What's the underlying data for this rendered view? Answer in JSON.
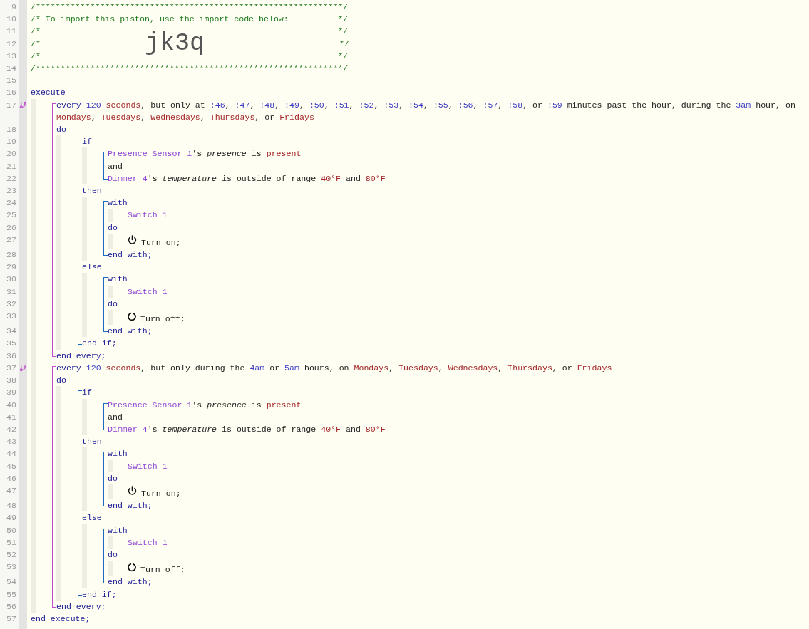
{
  "code": [
    {
      "kind": "line",
      "num": "9",
      "tokens": [
        {
          "text": "/**************************************************************/",
          "kind": "cmt"
        }
      ]
    },
    {
      "kind": "line",
      "num": "10",
      "tokens": [
        {
          "text": "/* To import this piston, use the import code below:          */",
          "kind": "cmt"
        }
      ]
    },
    {
      "kind": "line",
      "num": "11",
      "tokens": [
        {
          "text": "/*                                                            */",
          "kind": "cmt"
        }
      ]
    },
    {
      "kind": "import",
      "num": "12",
      "head": "/*",
      "import_code": "jk3q",
      "tail": "*/"
    },
    {
      "kind": "line",
      "num": "13",
      "tokens": [
        {
          "text": "/*                                                            */",
          "kind": "cmt"
        }
      ]
    },
    {
      "kind": "line",
      "num": "14",
      "tokens": [
        {
          "text": "/**************************************************************/",
          "kind": "cmt"
        }
      ]
    },
    {
      "kind": "line",
      "num": "15"
    },
    {
      "kind": "line",
      "num": "16",
      "tokens": [
        {
          "text": "execute",
          "kind": "kw"
        }
      ],
      "children": [
        {
          "kind": "every",
          "items": [
            {
              "kind": "trigger",
              "num": "17",
              "tokens": [
                {
                  "text": "every",
                  "kind": "kw"
                },
                {
                  "text": " 120",
                  "kind": "num"
                },
                {
                  "text": " seconds",
                  "kind": "val"
                },
                {
                  "text": ", but only at ",
                  "kind": "txt"
                },
                {
                  "text": ":46",
                  "kind": "num"
                },
                {
                  "text": ", ",
                  "kind": "txt"
                },
                {
                  "text": ":47",
                  "kind": "num"
                },
                {
                  "text": ", ",
                  "kind": "txt"
                },
                {
                  "text": ":48",
                  "kind": "num"
                },
                {
                  "text": ", ",
                  "kind": "txt"
                },
                {
                  "text": ":49",
                  "kind": "num"
                },
                {
                  "text": ", ",
                  "kind": "txt"
                },
                {
                  "text": ":50",
                  "kind": "num"
                },
                {
                  "text": ", ",
                  "kind": "txt"
                },
                {
                  "text": ":51",
                  "kind": "num"
                },
                {
                  "text": ", ",
                  "kind": "txt"
                },
                {
                  "text": ":52",
                  "kind": "num"
                },
                {
                  "text": ", ",
                  "kind": "txt"
                },
                {
                  "text": ":53",
                  "kind": "num"
                },
                {
                  "text": ", ",
                  "kind": "txt"
                },
                {
                  "text": ":54",
                  "kind": "num"
                },
                {
                  "text": ", ",
                  "kind": "txt"
                },
                {
                  "text": ":55",
                  "kind": "num"
                },
                {
                  "text": ", ",
                  "kind": "txt"
                },
                {
                  "text": ":56",
                  "kind": "num"
                },
                {
                  "text": ", ",
                  "kind": "txt"
                },
                {
                  "text": ":57",
                  "kind": "num"
                },
                {
                  "text": ", ",
                  "kind": "txt"
                },
                {
                  "text": ":58",
                  "kind": "num"
                },
                {
                  "text": ", or ",
                  "kind": "txt"
                },
                {
                  "text": ":59",
                  "kind": "num"
                },
                {
                  "text": " minutes past the hour, during the ",
                  "kind": "txt"
                },
                {
                  "text": "3am",
                  "kind": "num"
                },
                {
                  "text": " hour, on ",
                  "kind": "txt"
                },
                {
                  "text": "Mondays",
                  "kind": "val"
                },
                {
                  "text": ", ",
                  "kind": "txt"
                },
                {
                  "text": "Tuesdays",
                  "kind": "val"
                },
                {
                  "text": ", ",
                  "kind": "txt"
                },
                {
                  "text": "Wednesdays",
                  "kind": "val"
                },
                {
                  "text": ", ",
                  "kind": "txt"
                },
                {
                  "text": "Thursdays",
                  "kind": "val"
                },
                {
                  "text": ", or ",
                  "kind": "txt"
                },
                {
                  "text": "Fridays",
                  "kind": "val"
                }
              ]
            },
            {
              "kind": "line",
              "num": "18",
              "tokens": [
                {
                  "text": "do",
                  "kind": "kw"
                }
              ],
              "children": [
                {
                  "kind": "block",
                  "items": [
                    {
                      "kind": "line",
                      "num": "19",
                      "tokens": [
                        {
                          "text": "if",
                          "kind": "kw"
                        }
                      ],
                      "children": [
                        {
                          "kind": "block",
                          "items": [
                            {
                              "kind": "line",
                              "num": "20",
                              "tokens": [
                                {
                                  "text": "Presence Sensor 1",
                                  "kind": "dev"
                                },
                                {
                                  "text": "'s ",
                                  "kind": "txt"
                                },
                                {
                                  "text": "presence",
                                  "kind": "attr"
                                },
                                {
                                  "text": " is ",
                                  "kind": "txt"
                                },
                                {
                                  "text": "present",
                                  "kind": "val"
                                }
                              ]
                            },
                            {
                              "kind": "line",
                              "num": "21",
                              "tokens": [
                                {
                                  "text": "and",
                                  "kind": "txt"
                                }
                              ]
                            },
                            {
                              "kind": "line",
                              "num": "22",
                              "tokens": [
                                {
                                  "text": "Dimmer 4",
                                  "kind": "dev"
                                },
                                {
                                  "text": "'s ",
                                  "kind": "txt"
                                },
                                {
                                  "text": "temperature",
                                  "kind": "attr"
                                },
                                {
                                  "text": " is outside of range ",
                                  "kind": "txt"
                                },
                                {
                                  "text": "40°F",
                                  "kind": "val"
                                },
                                {
                                  "text": " and ",
                                  "kind": "txt"
                                },
                                {
                                  "text": "80°F",
                                  "kind": "val"
                                }
                              ]
                            }
                          ]
                        }
                      ]
                    },
                    {
                      "kind": "line",
                      "num": "23",
                      "tokens": [
                        {
                          "text": "then",
                          "kind": "kw"
                        }
                      ],
                      "children": [
                        {
                          "kind": "block",
                          "items": [
                            {
                              "kind": "line",
                              "num": "24",
                              "tokens": [
                                {
                                  "text": "with",
                                  "kind": "kw"
                                }
                              ],
                              "children": [
                                {
                                  "kind": "line",
                                  "num": "25",
                                  "tokens": [
                                    {
                                      "text": "Switch 1",
                                      "kind": "dev"
                                    }
                                  ]
                                }
                              ]
                            },
                            {
                              "kind": "line",
                              "num": "26",
                              "tokens": [
                                {
                                  "text": "do",
                                  "kind": "kw"
                                }
                              ],
                              "children": [
                                {
                                  "kind": "poweron",
                                  "num": "27",
                                  "tokens": [
                                    {
                                      "text": "Turn on;",
                                      "kind": "txt"
                                    }
                                  ]
                                }
                              ]
                            },
                            {
                              "kind": "line",
                              "num": "28",
                              "tokens": [
                                {
                                  "text": "end with;",
                                  "kind": "kw"
                                }
                              ]
                            }
                          ]
                        }
                      ]
                    },
                    {
                      "kind": "line",
                      "num": "29",
                      "tokens": [
                        {
                          "text": "else",
                          "kind": "kw"
                        }
                      ],
                      "children": [
                        {
                          "kind": "block",
                          "items": [
                            {
                              "kind": "line",
                              "num": "30",
                              "tokens": [
                                {
                                  "text": "with",
                                  "kind": "kw"
                                }
                              ],
                              "children": [
                                {
                                  "kind": "line",
                                  "num": "31",
                                  "tokens": [
                                    {
                                      "text": "Switch 1",
                                      "kind": "dev"
                                    }
                                  ]
                                }
                              ]
                            },
                            {
                              "kind": "line",
                              "num": "32",
                              "tokens": [
                                {
                                  "text": "do",
                                  "kind": "kw"
                                }
                              ],
                              "children": [
                                {
                                  "kind": "poweroff",
                                  "num": "33",
                                  "tokens": [
                                    {
                                      "text": "Turn off;",
                                      "kind": "txt"
                                    }
                                  ]
                                }
                              ]
                            },
                            {
                              "kind": "line",
                              "num": "34",
                              "tokens": [
                                {
                                  "text": "end with;",
                                  "kind": "kw"
                                }
                              ]
                            }
                          ]
                        }
                      ]
                    },
                    {
                      "kind": "line",
                      "num": "35",
                      "tokens": [
                        {
                          "text": "end if;",
                          "kind": "kw"
                        }
                      ]
                    }
                  ]
                }
              ]
            },
            {
              "kind": "line",
              "num": "36",
              "tokens": [
                {
                  "text": "end every;",
                  "kind": "kw"
                }
              ]
            }
          ]
        },
        {
          "kind": "every",
          "items": [
            {
              "kind": "trigger",
              "num": "37",
              "tokens": [
                {
                  "text": "every",
                  "kind": "kw"
                },
                {
                  "text": " 120",
                  "kind": "num"
                },
                {
                  "text": " seconds",
                  "kind": "val"
                },
                {
                  "text": ", but only during the ",
                  "kind": "txt"
                },
                {
                  "text": "4am",
                  "kind": "num"
                },
                {
                  "text": " or ",
                  "kind": "txt"
                },
                {
                  "text": "5am",
                  "kind": "num"
                },
                {
                  "text": " hours, on ",
                  "kind": "txt"
                },
                {
                  "text": "Mondays",
                  "kind": "val"
                },
                {
                  "text": ", ",
                  "kind": "txt"
                },
                {
                  "text": "Tuesdays",
                  "kind": "val"
                },
                {
                  "text": ", ",
                  "kind": "txt"
                },
                {
                  "text": "Wednesdays",
                  "kind": "val"
                },
                {
                  "text": ", ",
                  "kind": "txt"
                },
                {
                  "text": "Thursdays",
                  "kind": "val"
                },
                {
                  "text": ", or ",
                  "kind": "txt"
                },
                {
                  "text": "Fridays",
                  "kind": "val"
                }
              ]
            },
            {
              "kind": "line",
              "num": "38",
              "tokens": [
                {
                  "text": "do",
                  "kind": "kw"
                }
              ],
              "children": [
                {
                  "kind": "block",
                  "items": [
                    {
                      "kind": "line",
                      "num": "39",
                      "tokens": [
                        {
                          "text": "if",
                          "kind": "kw"
                        }
                      ],
                      "children": [
                        {
                          "kind": "block",
                          "items": [
                            {
                              "kind": "line",
                              "num": "40",
                              "tokens": [
                                {
                                  "text": "Presence Sensor 1",
                                  "kind": "dev"
                                },
                                {
                                  "text": "'s ",
                                  "kind": "txt"
                                },
                                {
                                  "text": "presence",
                                  "kind": "attr"
                                },
                                {
                                  "text": " is ",
                                  "kind": "txt"
                                },
                                {
                                  "text": "present",
                                  "kind": "val"
                                }
                              ]
                            },
                            {
                              "kind": "line",
                              "num": "41",
                              "tokens": [
                                {
                                  "text": "and",
                                  "kind": "txt"
                                }
                              ]
                            },
                            {
                              "kind": "line",
                              "num": "42",
                              "tokens": [
                                {
                                  "text": "Dimmer 4",
                                  "kind": "dev"
                                },
                                {
                                  "text": "'s ",
                                  "kind": "txt"
                                },
                                {
                                  "text": "temperature",
                                  "kind": "attr"
                                },
                                {
                                  "text": " is outside of range ",
                                  "kind": "txt"
                                },
                                {
                                  "text": "40°F",
                                  "kind": "val"
                                },
                                {
                                  "text": " and ",
                                  "kind": "txt"
                                },
                                {
                                  "text": "80°F",
                                  "kind": "val"
                                }
                              ]
                            }
                          ]
                        }
                      ]
                    },
                    {
                      "kind": "line",
                      "num": "43",
                      "tokens": [
                        {
                          "text": "then",
                          "kind": "kw"
                        }
                      ],
                      "children": [
                        {
                          "kind": "block",
                          "items": [
                            {
                              "kind": "line",
                              "num": "44",
                              "tokens": [
                                {
                                  "text": "with",
                                  "kind": "kw"
                                }
                              ],
                              "children": [
                                {
                                  "kind": "line",
                                  "num": "45",
                                  "tokens": [
                                    {
                                      "text": "Switch 1",
                                      "kind": "dev"
                                    }
                                  ]
                                }
                              ]
                            },
                            {
                              "kind": "line",
                              "num": "46",
                              "tokens": [
                                {
                                  "text": "do",
                                  "kind": "kw"
                                }
                              ],
                              "children": [
                                {
                                  "kind": "poweron",
                                  "num": "47",
                                  "tokens": [
                                    {
                                      "text": "Turn on;",
                                      "kind": "txt"
                                    }
                                  ]
                                }
                              ]
                            },
                            {
                              "kind": "line",
                              "num": "48",
                              "tokens": [
                                {
                                  "text": "end with;",
                                  "kind": "kw"
                                }
                              ]
                            }
                          ]
                        }
                      ]
                    },
                    {
                      "kind": "line",
                      "num": "49",
                      "tokens": [
                        {
                          "text": "else",
                          "kind": "kw"
                        }
                      ],
                      "children": [
                        {
                          "kind": "block",
                          "items": [
                            {
                              "kind": "line",
                              "num": "50",
                              "tokens": [
                                {
                                  "text": "with",
                                  "kind": "kw"
                                }
                              ],
                              "children": [
                                {
                                  "kind": "line",
                                  "num": "51",
                                  "tokens": [
                                    {
                                      "text": "Switch 1",
                                      "kind": "dev"
                                    }
                                  ]
                                }
                              ]
                            },
                            {
                              "kind": "line",
                              "num": "52",
                              "tokens": [
                                {
                                  "text": "do",
                                  "kind": "kw"
                                }
                              ],
                              "children": [
                                {
                                  "kind": "poweroff",
                                  "num": "53",
                                  "tokens": [
                                    {
                                      "text": "Turn off;",
                                      "kind": "txt"
                                    }
                                  ]
                                }
                              ]
                            },
                            {
                              "kind": "line",
                              "num": "54",
                              "tokens": [
                                {
                                  "text": "end with;",
                                  "kind": "kw"
                                }
                              ]
                            }
                          ]
                        }
                      ]
                    },
                    {
                      "kind": "line",
                      "num": "55",
                      "tokens": [
                        {
                          "text": "end if;",
                          "kind": "kw"
                        }
                      ]
                    }
                  ]
                }
              ]
            },
            {
              "kind": "line",
              "num": "56",
              "tokens": [
                {
                  "text": "end every;",
                  "kind": "kw"
                }
              ]
            }
          ]
        }
      ]
    },
    {
      "kind": "line",
      "num": "57",
      "tokens": [
        {
          "text": "end execute;",
          "kind": "kw"
        }
      ]
    }
  ]
}
